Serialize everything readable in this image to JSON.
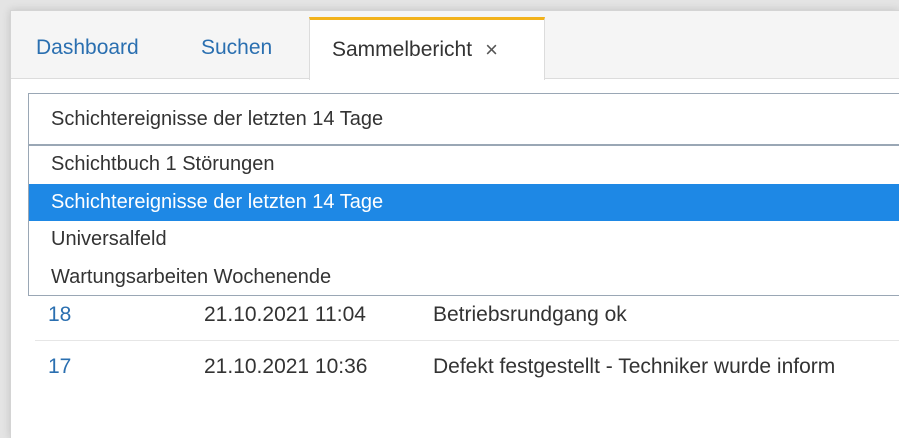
{
  "tabs": {
    "dashboard": "Dashboard",
    "suchen": "Suchen",
    "sammelbericht": "Sammelbericht",
    "close_icon": "×"
  },
  "report_select": {
    "value": "Schichtereignisse der letzten 14 Tage",
    "options": [
      "Schichtbuch 1 Störungen",
      "Schichtereignisse der letzten 14 Tage",
      "Universalfeld",
      "Wartungsarbeiten Wochenende"
    ],
    "selected_index": 1
  },
  "table": {
    "rows": [
      {
        "id": "18",
        "date": "21.10.2021 11:04",
        "text": "Betriebsrundgang ok"
      },
      {
        "id": "17",
        "date": "21.10.2021 10:36",
        "text": "Defekt festgestellt - Techniker wurde inform"
      }
    ]
  },
  "colors": {
    "active_tab_accent": "#f2b21b",
    "link": "#2a6fb0",
    "selection": "#1e88e5"
  }
}
